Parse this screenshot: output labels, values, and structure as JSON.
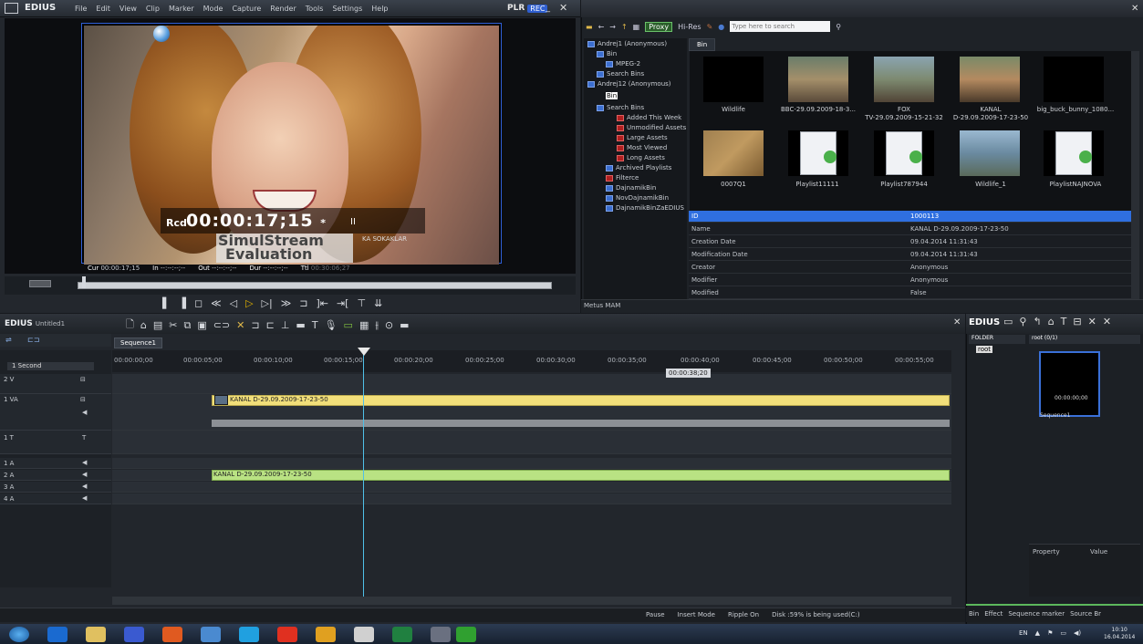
{
  "player": {
    "app_name": "EDIUS",
    "menu": [
      "File",
      "Edit",
      "View",
      "Clip",
      "Marker",
      "Mode",
      "Capture",
      "Render",
      "Tools",
      "Settings",
      "Help"
    ],
    "mode_label": "PLR",
    "rec_badge": "REC",
    "overlay_rcd_label": "Rcd",
    "overlay_timecode": "00:00:17;15",
    "overlay_asterisk": "*",
    "overlay_pause": "II",
    "overlay_channel": "KA SOKAKLAR",
    "watermark_line1": "SimulStream",
    "watermark_line2": "Evaluation",
    "cur_label": "Cur",
    "cur_value": "00:00:17;15",
    "in_label": "In",
    "in_value": "--:--:--;--",
    "out_label": "Out",
    "out_value": "--:--:--;--",
    "dur_label": "Dur",
    "dur_value": "--:--:--;--",
    "ttl_label": "Ttl",
    "ttl_value": "00:30:06;27",
    "scrub_progress": 0.01
  },
  "bin": {
    "proxy_label": "Proxy",
    "hires_label": "Hi-Res",
    "search_placeholder": "Type here to search",
    "tab": "Bin",
    "tree": [
      {
        "label": "Andrej1 (Anonymous)"
      },
      {
        "label": "Bin"
      },
      {
        "label": "MPEG-2"
      },
      {
        "label": "Search Bins"
      },
      {
        "label": "Andrej12 (Anonymous)"
      },
      {
        "label": "Bin"
      },
      {
        "label": "Search Bins"
      },
      {
        "label": "Added This Week"
      },
      {
        "label": "Unmodified Assets"
      },
      {
        "label": "Large Assets"
      },
      {
        "label": "Most Viewed"
      },
      {
        "label": "Long Assets"
      },
      {
        "label": "Archived Playlists"
      },
      {
        "label": "Filterce"
      },
      {
        "label": "DajnamikBin"
      },
      {
        "label": "NovDajnamikBin"
      },
      {
        "label": "DajnamikBinZaEDIUS"
      }
    ],
    "thumbnails": [
      {
        "label": "Wildlife"
      },
      {
        "label": "BBC-29.09.2009-18-3..."
      },
      {
        "label": "FOX"
      },
      {
        "label": "KANAL"
      },
      {
        "label": "big_buck_bunny_1080..."
      },
      {
        "label": "0007Q1"
      },
      {
        "label": "Playlist11111"
      },
      {
        "label": "Playlist787944"
      },
      {
        "label": "Wildlife_1"
      },
      {
        "label": "PlaylistNAJNOVA"
      }
    ],
    "thumb_sub_fox": "TV-29.09.2009-15-21-32",
    "thumb_sub_kanal": "D-29.09.2009-17-23-50",
    "properties": [
      {
        "key": "ID",
        "value": "1000113"
      },
      {
        "key": "Name",
        "value": "KANAL D-29.09.2009-17-23-50"
      },
      {
        "key": "Creation Date",
        "value": "09.04.2014 11:31:43"
      },
      {
        "key": "Modification Date",
        "value": "09.04.2014 11:31:43"
      },
      {
        "key": "Creator",
        "value": "Anonymous"
      },
      {
        "key": "Modifier",
        "value": "Anonymous"
      },
      {
        "key": "Modified",
        "value": "False"
      }
    ],
    "footer": "Metus MAM"
  },
  "timeline": {
    "app_name": "EDIUS",
    "project": "Untitled1",
    "sequence_tab": "Sequence1",
    "scale": "1 Second",
    "ruler": [
      "00:00:00;00",
      "00:00:05;00",
      "00:00:10;00",
      "00:00:15;00",
      "00:00:20;00",
      "00:00:25;00",
      "00:00:30;00",
      "00:00:35;00",
      "00:00:40;00",
      "00:00:45;00",
      "00:00:50;00",
      "00:00:55;00"
    ],
    "tooltip": "00:00:38;20",
    "tracks": [
      {
        "name": "2 V"
      },
      {
        "name": "1 VA"
      },
      {
        "name": "1 T"
      },
      {
        "name": "1 A"
      },
      {
        "name": "2 A"
      },
      {
        "name": "3 A"
      },
      {
        "name": "4 A"
      }
    ],
    "clip_video": "KANAL D-29.09.2009-17-23-50",
    "clip_audio": "KANAL D-29.09.2009-17-23-50",
    "status": [
      "Pause",
      "Insert Mode",
      "Ripple On",
      "Disk :59% is being used(C:)"
    ]
  },
  "right": {
    "app_name": "EDIUS",
    "folder_header": "FOLDER",
    "root_header": "root (0/1)",
    "root_label": "root",
    "seq_label": "Sequence1",
    "seq_tc": "00:00:00;00",
    "prop_col": "Property",
    "value_col": "Value",
    "tabs": [
      "Bin",
      "Effect",
      "Sequence marker",
      "Source Br"
    ]
  },
  "taskbar": {
    "lang": "EN",
    "time": "10:10",
    "date": "16.04.2014"
  }
}
